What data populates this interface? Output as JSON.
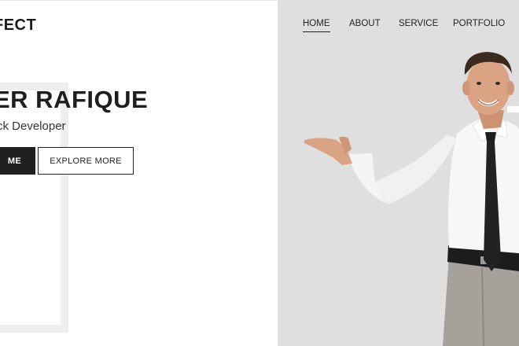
{
  "brand": {
    "logo_text": "FECT"
  },
  "hero": {
    "name": "ER RAFIQUE",
    "role": "ck Developer",
    "primary_button": "ME",
    "secondary_button": "EXPLORE MORE"
  },
  "nav": {
    "items": [
      {
        "label": "HOME",
        "active": true
      },
      {
        "label": "ABOUT",
        "active": false
      },
      {
        "label": "SERVICE",
        "active": false
      },
      {
        "label": "PORTFOLIO",
        "active": false
      }
    ]
  },
  "colors": {
    "left_bg": "#ffffff",
    "right_bg": "#dfdfdf",
    "accent_dark": "#202020",
    "frame": "#eeeeee"
  }
}
